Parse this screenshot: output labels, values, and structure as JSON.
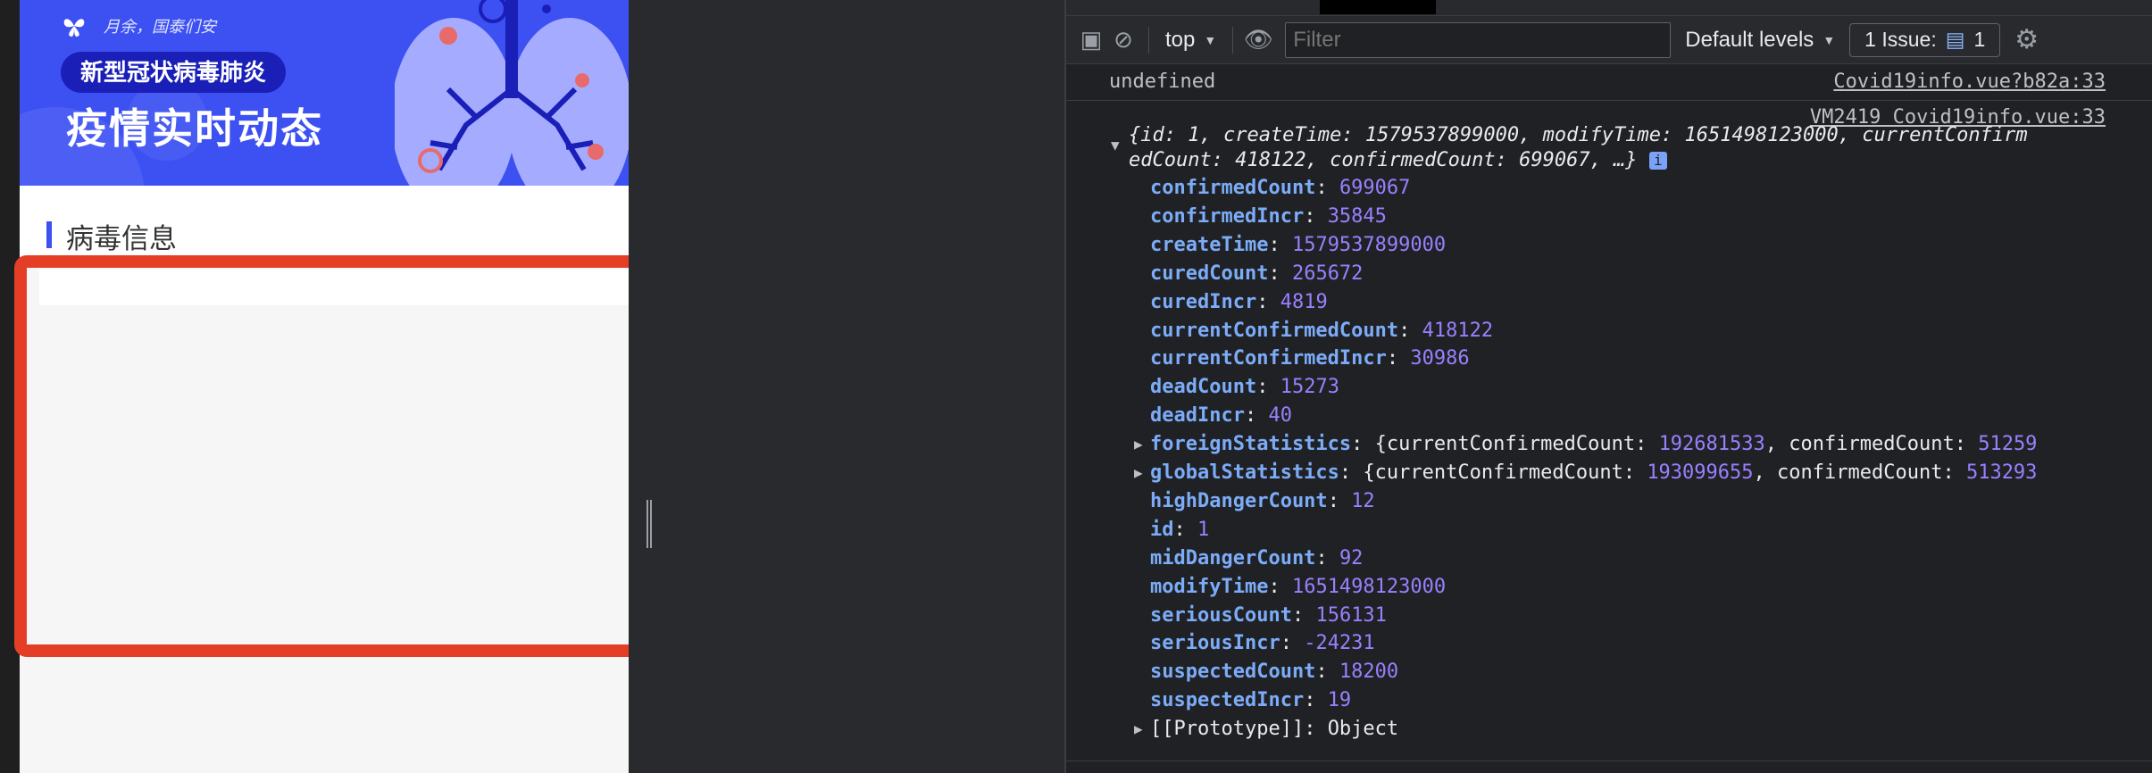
{
  "page": {
    "slogan": "月余，国泰们安",
    "pill_title": "新型冠状病毒肺炎",
    "headline": "疫情实时动态",
    "section_title": "病毒信息"
  },
  "toolbar": {
    "context": "top",
    "filter_placeholder": "Filter",
    "levels": "Default levels",
    "issues_label": "1 Issue:",
    "issues_count": "1"
  },
  "console": {
    "msg1_text": "undefined",
    "msg1_source": "Covid19info.vue?b82a:33",
    "msg2_source": "VM2419 Covid19info.vue:33",
    "summary_line1": "{id: 1, createTime: 1579537899000, modifyTime: 1651498123000, currentConfirm",
    "summary_line2": "edCount: 418122, confirmedCount: 699067, …}",
    "properties": [
      {
        "key": "confirmedCount",
        "value": "699067"
      },
      {
        "key": "confirmedIncr",
        "value": "35845"
      },
      {
        "key": "createTime",
        "value": "1579537899000"
      },
      {
        "key": "curedCount",
        "value": "265672"
      },
      {
        "key": "curedIncr",
        "value": "4819"
      },
      {
        "key": "currentConfirmedCount",
        "value": "418122"
      },
      {
        "key": "currentConfirmedIncr",
        "value": "30986"
      },
      {
        "key": "deadCount",
        "value": "15273"
      },
      {
        "key": "deadIncr",
        "value": "40"
      },
      {
        "key": "foreignStatistics",
        "value": "{currentConfirmedCount: 192681533, confirmedCount: 51259",
        "expandable": true
      },
      {
        "key": "globalStatistics",
        "value": "{currentConfirmedCount: 193099655, confirmedCount: 513293",
        "expandable": true
      },
      {
        "key": "highDangerCount",
        "value": "12"
      },
      {
        "key": "id",
        "value": "1"
      },
      {
        "key": "midDangerCount",
        "value": "92"
      },
      {
        "key": "modifyTime",
        "value": "1651498123000"
      },
      {
        "key": "seriousCount",
        "value": "156131"
      },
      {
        "key": "seriousIncr",
        "value": "-24231"
      },
      {
        "key": "suspectedCount",
        "value": "18200"
      },
      {
        "key": "suspectedIncr",
        "value": "19"
      },
      {
        "key": "[[Prototype]]",
        "value": "Object",
        "expandable": true,
        "plain": true
      }
    ]
  },
  "colors": {
    "banner": "#3d51f2",
    "highlight": "#e53e26",
    "console_key": "#7cacf8",
    "console_value": "#9980ff"
  }
}
